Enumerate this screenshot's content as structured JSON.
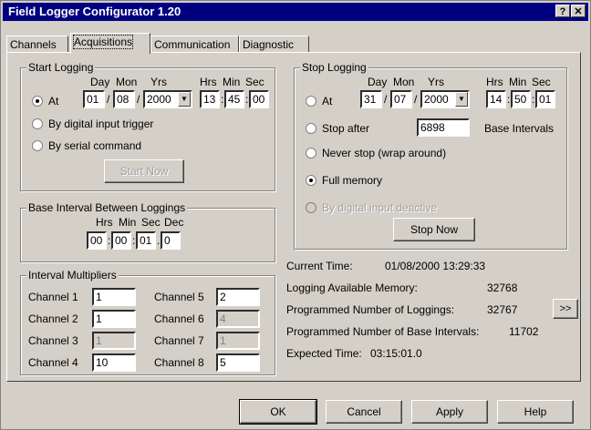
{
  "window": {
    "title": "Field Logger Configurator 1.20",
    "help_label": "?",
    "close_label": "✕"
  },
  "tabs": [
    {
      "label": "Channels"
    },
    {
      "label": "Acquisitions"
    },
    {
      "label": "Communication"
    },
    {
      "label": "Diagnostic"
    }
  ],
  "start_logging": {
    "title": "Start Logging",
    "headers": {
      "day": "Day",
      "mon": "Mon",
      "yrs": "Yrs",
      "hrs": "Hrs",
      "min": "Min",
      "sec": "Sec"
    },
    "at_label": "At",
    "day": "01",
    "mon": "08",
    "yrs": "2000",
    "hrs": "13",
    "min": "45",
    "sec": "00",
    "digital_label": "By digital input trigger",
    "serial_label": "By serial command",
    "start_now_label": "Start Now",
    "selected": "at"
  },
  "stop_logging": {
    "title": "Stop Logging",
    "headers": {
      "day": "Day",
      "mon": "Mon",
      "yrs": "Yrs",
      "hrs": "Hrs",
      "min": "Min",
      "sec": "Sec"
    },
    "at_label": "At",
    "day": "31",
    "mon": "07",
    "yrs": "2000",
    "hrs": "14",
    "min": "50",
    "sec": "01",
    "stop_after_label": "Stop after",
    "stop_after_value": "6898",
    "base_intervals_label": "Base Intervals",
    "never_stop_label": "Never stop (wrap around)",
    "full_memory_label": "Full memory",
    "digital_deactive_label": "By digital input deactive",
    "stop_now_label": "Stop Now",
    "selected": "full_memory"
  },
  "base_interval": {
    "title": "Base Interval Between Loggings",
    "headers": {
      "hrs": "Hrs",
      "min": "Min",
      "sec": "Sec",
      "dec": "Dec"
    },
    "hrs": "00",
    "min": "00",
    "sec": "01",
    "dec": "0"
  },
  "multipliers": {
    "title": "Interval Multipliers",
    "channels": [
      {
        "label": "Channel 1",
        "value": "1",
        "enabled": true
      },
      {
        "label": "Channel 2",
        "value": "1",
        "enabled": true
      },
      {
        "label": "Channel 3",
        "value": "1",
        "enabled": false
      },
      {
        "label": "Channel 4",
        "value": "10",
        "enabled": true
      },
      {
        "label": "Channel 5",
        "value": "2",
        "enabled": true
      },
      {
        "label": "Channel 6",
        "value": "4",
        "enabled": false
      },
      {
        "label": "Channel 7",
        "value": "1",
        "enabled": false
      },
      {
        "label": "Channel 8",
        "value": "5",
        "enabled": true
      }
    ]
  },
  "info": {
    "current_time_label": "Current Time:",
    "current_time_value": "01/08/2000  13:29:33",
    "memory_label": "Logging Available Memory:",
    "memory_value": "32768",
    "num_loggings_label": "Programmed Number of Loggings:",
    "num_loggings_value": "32767",
    "more_label": ">>",
    "num_base_label": "Programmed Number of Base Intervals:",
    "num_base_value": "11702",
    "expected_label": "Expected Time:",
    "expected_value": "03:15:01.0"
  },
  "buttons": {
    "ok": "OK",
    "cancel": "Cancel",
    "apply": "Apply",
    "help": "Help"
  }
}
